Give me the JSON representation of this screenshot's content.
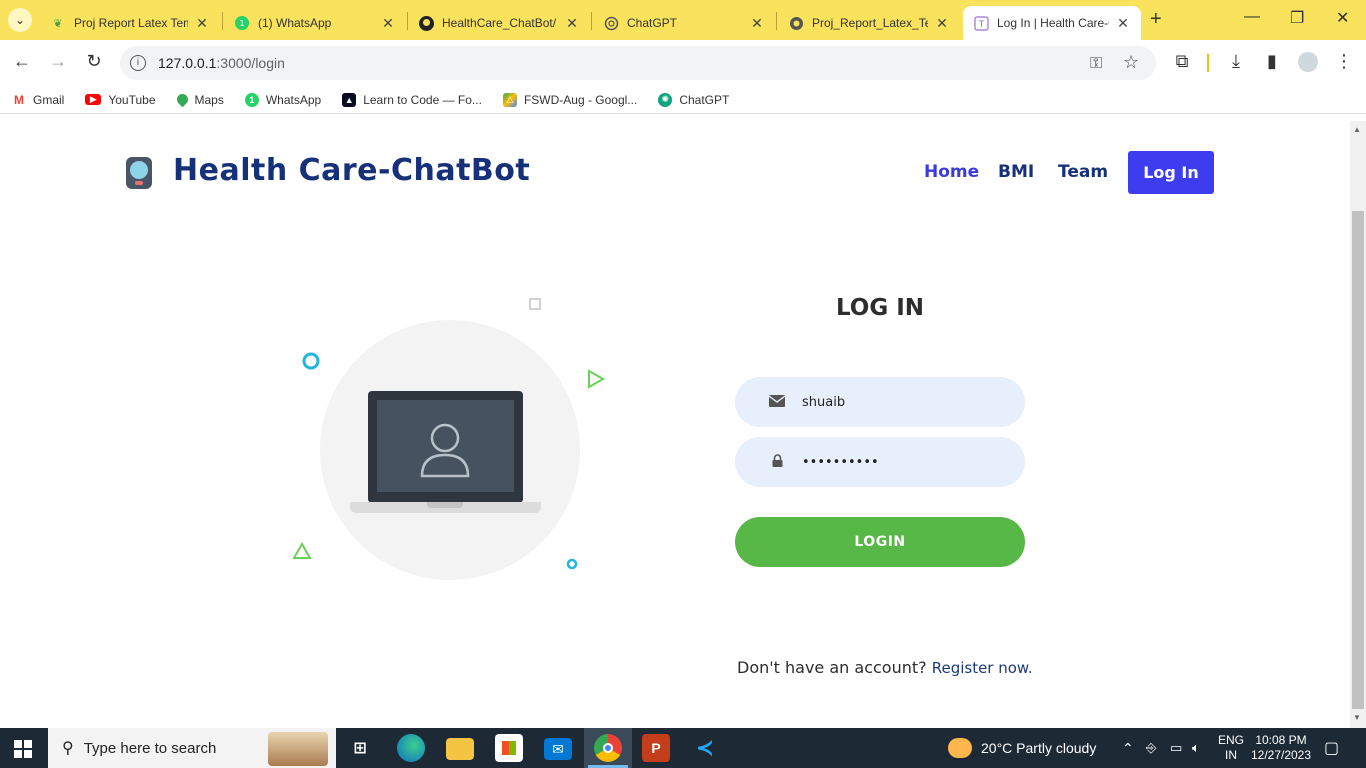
{
  "browser": {
    "tabs": [
      {
        "title": "Proj Report Latex Tem",
        "favicon": "overleaf-icon",
        "color": "#47a141"
      },
      {
        "title": "(1) WhatsApp",
        "favicon": "whatsapp-icon",
        "color": "#25d366"
      },
      {
        "title": "HealthCare_ChatBot/",
        "favicon": "github-icon",
        "color": "#222222"
      },
      {
        "title": "ChatGPT",
        "favicon": "chatgpt-icon",
        "color": "#10a37f"
      },
      {
        "title": "Proj_Report_Latex_Te",
        "favicon": "globe-icon",
        "color": "#555555"
      },
      {
        "title": "Log In | Health Care-C",
        "favicon": "page-icon",
        "color": "#9c6fd3"
      }
    ],
    "url_host": "127.0.0.1",
    "url_path": ":3000/login",
    "bookmarks": [
      {
        "label": "Gmail",
        "icon": "gmail-icon",
        "color": "#ea4335"
      },
      {
        "label": "YouTube",
        "icon": "youtube-icon",
        "color": "#ff0000"
      },
      {
        "label": "Maps",
        "icon": "maps-icon",
        "color": "#34a853"
      },
      {
        "label": "WhatsApp",
        "icon": "whatsapp-icon",
        "color": "#25d366"
      },
      {
        "label": "Learn to Code — Fo...",
        "icon": "freecodecamp-icon",
        "color": "#0a0a23"
      },
      {
        "label": "FSWD-Aug - Googl...",
        "icon": "drive-icon",
        "color": "#fbbc04"
      },
      {
        "label": "ChatGPT",
        "icon": "chatgpt-icon",
        "color": "#10a37f"
      }
    ]
  },
  "page": {
    "brand": "Health Care-ChatBot",
    "nav": {
      "home": "Home",
      "bmi": "BMI",
      "team": "Team",
      "login": "Log In"
    },
    "form": {
      "title": "LOG IN",
      "username": "shuaib",
      "password": "••••••••••",
      "submit": "LOGIN",
      "no_account": "Don't have an account?",
      "register": "Register now."
    },
    "colors": {
      "brand": "#17307a",
      "primary": "#3d3def",
      "login_button": "#57b847",
      "input_bg": "#e8effc"
    }
  },
  "taskbar": {
    "search_placeholder": "Type here to search",
    "weather": "20°C  Partly cloudy",
    "lang_top": "ENG",
    "lang_bottom": "IN",
    "time": "10:08 PM",
    "date": "12/27/2023"
  }
}
